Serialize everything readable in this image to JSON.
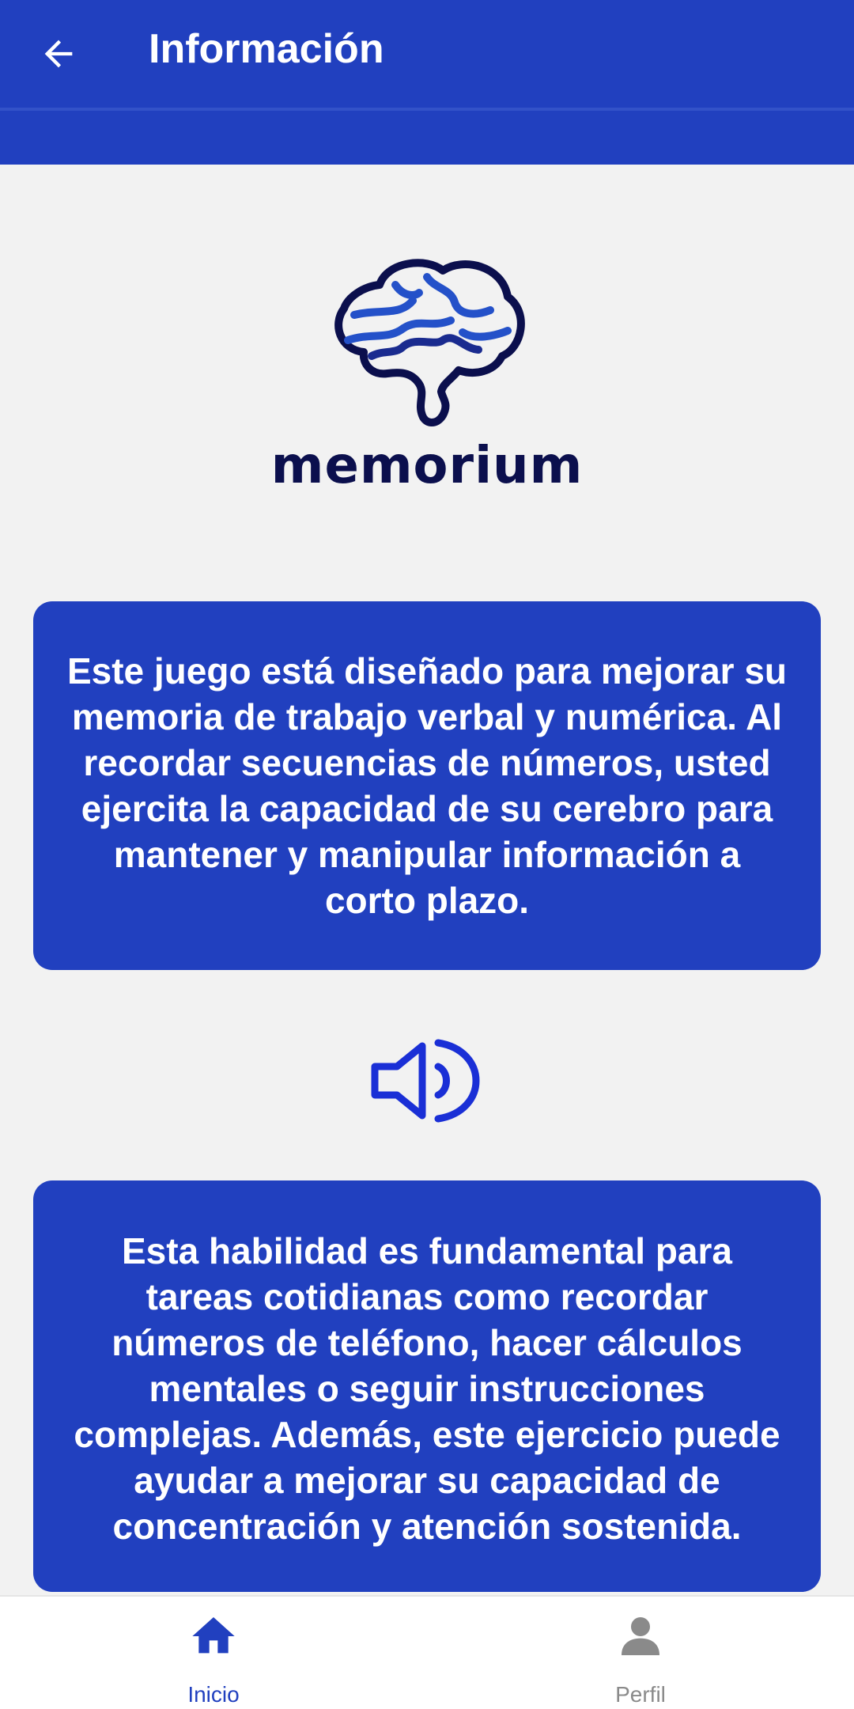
{
  "header": {
    "title": "Información",
    "back_icon": "arrow-left-icon"
  },
  "logo": {
    "icon": "brain-icon",
    "text": "memorium"
  },
  "cards": [
    {
      "text": "Este juego está diseñado para mejorar su memoria de trabajo verbal y numérica. Al recordar secuencias de números, usted ejercita la capacidad de su cerebro para mantener y manipular información a corto plazo."
    },
    {
      "text": "Esta habilidad es fundamental para tareas cotidianas como recordar números de teléfono, hacer cálculos mentales o seguir instrucciones complejas. Además, este ejercicio puede ayudar a mejorar su capacidad de concentración y atención sostenida."
    }
  ],
  "speaker": {
    "icon": "speaker-icon"
  },
  "bottom_nav": {
    "items": [
      {
        "label": "Inicio",
        "icon": "home-icon",
        "active": true
      },
      {
        "label": "Perfil",
        "icon": "person-icon",
        "active": false
      }
    ]
  },
  "colors": {
    "primary": "#2140bf",
    "background": "#f2f2f2",
    "logo_dark": "#0b0f4d",
    "inactive": "#8a8a8a"
  }
}
